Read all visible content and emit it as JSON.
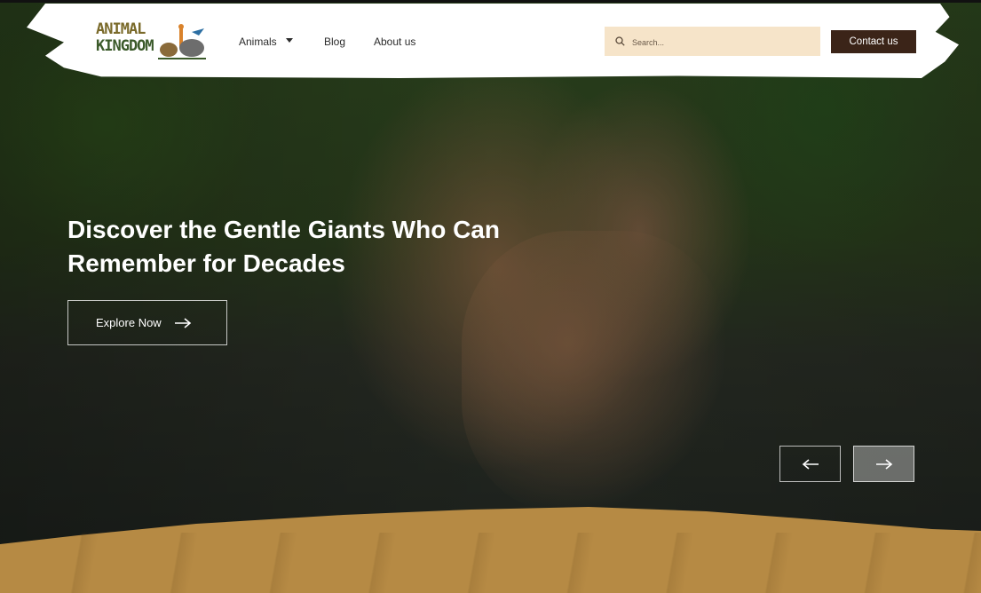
{
  "brand": {
    "logo_line1": "ANIMAL",
    "logo_line2": "KINGDOM"
  },
  "nav": {
    "items": [
      {
        "label": "Animals",
        "has_dropdown": true
      },
      {
        "label": "Blog"
      },
      {
        "label": "About us"
      }
    ]
  },
  "search": {
    "placeholder": "Search..."
  },
  "contact": {
    "label": "Contact us"
  },
  "hero": {
    "headline_line1": "Discover the Gentle Giants Who Can",
    "headline_line2": "Remember for Decades",
    "cta_label": "Explore Now"
  },
  "icons": {
    "search": "search-icon",
    "caret": "chevron-down-icon",
    "cta_arrow": "arrow-right-icon",
    "prev": "arrow-left-icon",
    "next": "arrow-right-icon"
  },
  "colors": {
    "contact_bg": "#3b2418",
    "search_bg": "#f6e4c9",
    "ground": "#b68a44"
  }
}
